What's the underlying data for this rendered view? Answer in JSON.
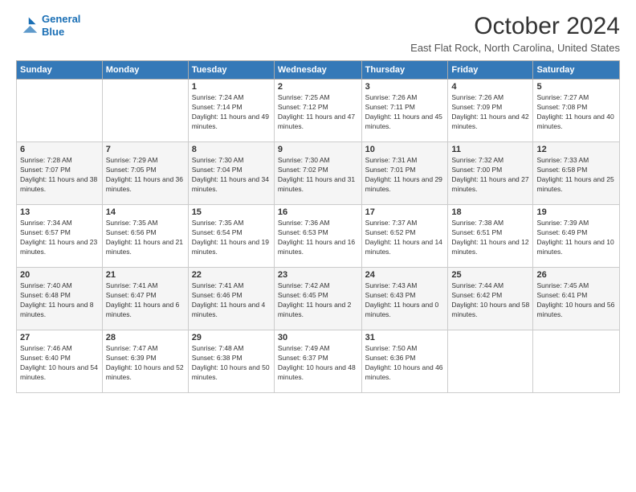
{
  "header": {
    "logo_line1": "General",
    "logo_line2": "Blue",
    "month_title": "October 2024",
    "location": "East Flat Rock, North Carolina, United States"
  },
  "weekdays": [
    "Sunday",
    "Monday",
    "Tuesday",
    "Wednesday",
    "Thursday",
    "Friday",
    "Saturday"
  ],
  "weeks": [
    [
      {
        "day": "",
        "info": ""
      },
      {
        "day": "",
        "info": ""
      },
      {
        "day": "1",
        "info": "Sunrise: 7:24 AM\nSunset: 7:14 PM\nDaylight: 11 hours and 49 minutes."
      },
      {
        "day": "2",
        "info": "Sunrise: 7:25 AM\nSunset: 7:12 PM\nDaylight: 11 hours and 47 minutes."
      },
      {
        "day": "3",
        "info": "Sunrise: 7:26 AM\nSunset: 7:11 PM\nDaylight: 11 hours and 45 minutes."
      },
      {
        "day": "4",
        "info": "Sunrise: 7:26 AM\nSunset: 7:09 PM\nDaylight: 11 hours and 42 minutes."
      },
      {
        "day": "5",
        "info": "Sunrise: 7:27 AM\nSunset: 7:08 PM\nDaylight: 11 hours and 40 minutes."
      }
    ],
    [
      {
        "day": "6",
        "info": "Sunrise: 7:28 AM\nSunset: 7:07 PM\nDaylight: 11 hours and 38 minutes."
      },
      {
        "day": "7",
        "info": "Sunrise: 7:29 AM\nSunset: 7:05 PM\nDaylight: 11 hours and 36 minutes."
      },
      {
        "day": "8",
        "info": "Sunrise: 7:30 AM\nSunset: 7:04 PM\nDaylight: 11 hours and 34 minutes."
      },
      {
        "day": "9",
        "info": "Sunrise: 7:30 AM\nSunset: 7:02 PM\nDaylight: 11 hours and 31 minutes."
      },
      {
        "day": "10",
        "info": "Sunrise: 7:31 AM\nSunset: 7:01 PM\nDaylight: 11 hours and 29 minutes."
      },
      {
        "day": "11",
        "info": "Sunrise: 7:32 AM\nSunset: 7:00 PM\nDaylight: 11 hours and 27 minutes."
      },
      {
        "day": "12",
        "info": "Sunrise: 7:33 AM\nSunset: 6:58 PM\nDaylight: 11 hours and 25 minutes."
      }
    ],
    [
      {
        "day": "13",
        "info": "Sunrise: 7:34 AM\nSunset: 6:57 PM\nDaylight: 11 hours and 23 minutes."
      },
      {
        "day": "14",
        "info": "Sunrise: 7:35 AM\nSunset: 6:56 PM\nDaylight: 11 hours and 21 minutes."
      },
      {
        "day": "15",
        "info": "Sunrise: 7:35 AM\nSunset: 6:54 PM\nDaylight: 11 hours and 19 minutes."
      },
      {
        "day": "16",
        "info": "Sunrise: 7:36 AM\nSunset: 6:53 PM\nDaylight: 11 hours and 16 minutes."
      },
      {
        "day": "17",
        "info": "Sunrise: 7:37 AM\nSunset: 6:52 PM\nDaylight: 11 hours and 14 minutes."
      },
      {
        "day": "18",
        "info": "Sunrise: 7:38 AM\nSunset: 6:51 PM\nDaylight: 11 hours and 12 minutes."
      },
      {
        "day": "19",
        "info": "Sunrise: 7:39 AM\nSunset: 6:49 PM\nDaylight: 11 hours and 10 minutes."
      }
    ],
    [
      {
        "day": "20",
        "info": "Sunrise: 7:40 AM\nSunset: 6:48 PM\nDaylight: 11 hours and 8 minutes."
      },
      {
        "day": "21",
        "info": "Sunrise: 7:41 AM\nSunset: 6:47 PM\nDaylight: 11 hours and 6 minutes."
      },
      {
        "day": "22",
        "info": "Sunrise: 7:41 AM\nSunset: 6:46 PM\nDaylight: 11 hours and 4 minutes."
      },
      {
        "day": "23",
        "info": "Sunrise: 7:42 AM\nSunset: 6:45 PM\nDaylight: 11 hours and 2 minutes."
      },
      {
        "day": "24",
        "info": "Sunrise: 7:43 AM\nSunset: 6:43 PM\nDaylight: 11 hours and 0 minutes."
      },
      {
        "day": "25",
        "info": "Sunrise: 7:44 AM\nSunset: 6:42 PM\nDaylight: 10 hours and 58 minutes."
      },
      {
        "day": "26",
        "info": "Sunrise: 7:45 AM\nSunset: 6:41 PM\nDaylight: 10 hours and 56 minutes."
      }
    ],
    [
      {
        "day": "27",
        "info": "Sunrise: 7:46 AM\nSunset: 6:40 PM\nDaylight: 10 hours and 54 minutes."
      },
      {
        "day": "28",
        "info": "Sunrise: 7:47 AM\nSunset: 6:39 PM\nDaylight: 10 hours and 52 minutes."
      },
      {
        "day": "29",
        "info": "Sunrise: 7:48 AM\nSunset: 6:38 PM\nDaylight: 10 hours and 50 minutes."
      },
      {
        "day": "30",
        "info": "Sunrise: 7:49 AM\nSunset: 6:37 PM\nDaylight: 10 hours and 48 minutes."
      },
      {
        "day": "31",
        "info": "Sunrise: 7:50 AM\nSunset: 6:36 PM\nDaylight: 10 hours and 46 minutes."
      },
      {
        "day": "",
        "info": ""
      },
      {
        "day": "",
        "info": ""
      }
    ]
  ]
}
